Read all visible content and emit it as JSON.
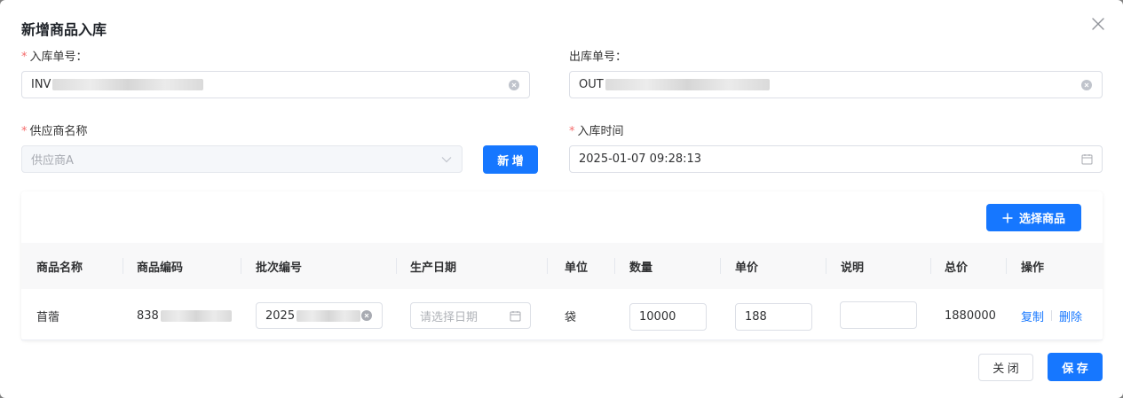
{
  "dialog": {
    "title": "新增商品入库",
    "close_label": "×"
  },
  "form": {
    "inbound_no": {
      "label": "入库单号：",
      "value_prefix": "INV",
      "required": true
    },
    "outbound_no": {
      "label": "出库单号：",
      "value_prefix": "OUT",
      "required": false
    },
    "supplier": {
      "label": "供应商名称",
      "value": "供应商A",
      "required": true,
      "disabled": true
    },
    "add_button": "新 增",
    "inbound_time": {
      "label": "入库时间",
      "value": "2025-01-07 09:28:13",
      "required": true
    },
    "required_mark": "*"
  },
  "table": {
    "select_button": "选择商品",
    "columns": [
      "商品名称",
      "商品编码",
      "批次编号",
      "生产日期",
      "单位",
      "数量",
      "单价",
      "说明",
      "总价",
      "操作"
    ],
    "rows": [
      {
        "name": "苜蓿",
        "code_prefix": "838",
        "batch_prefix": "2025",
        "date_placeholder": "请选择日期",
        "unit": "袋",
        "quantity": "10000",
        "price": "188",
        "note": "",
        "total": "1880000",
        "action_copy": "复制",
        "action_delete": "删除"
      }
    ]
  },
  "footer": {
    "close_button": "关 闭",
    "save_button": "保 存"
  },
  "colors": {
    "primary": "#1677ff",
    "required": "#f56c6c"
  }
}
